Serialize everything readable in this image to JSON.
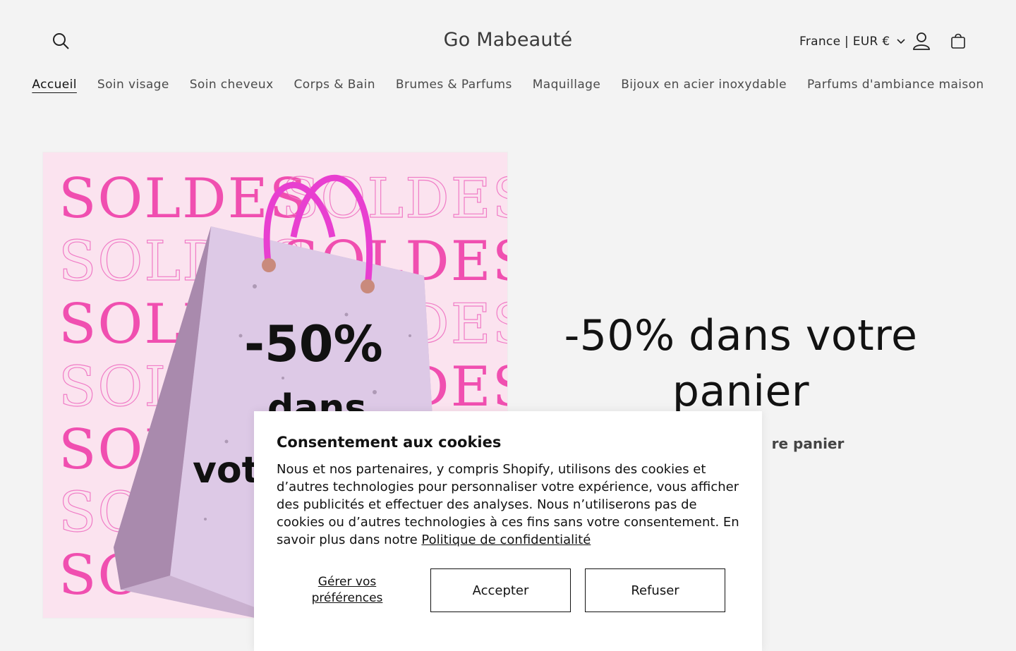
{
  "header": {
    "logo": "Go Mabeauté",
    "locale": "France | EUR €"
  },
  "nav": {
    "items": [
      "Accueil",
      "Soin visage",
      "Soin cheveux",
      "Corps & Bain",
      "Brumes & Parfums",
      "Maquillage",
      "Bijoux en acier inoxydable",
      "Parfums d'ambiance maison"
    ],
    "active": "Accueil"
  },
  "hero": {
    "image_text": {
      "word": "SOLDES",
      "discount": "-50%",
      "line2": "dans",
      "line3": "vot"
    },
    "title": "-50% dans votre panier",
    "subtitle_visible": "re panier"
  },
  "cookie": {
    "title": "Consentement aux cookies",
    "text": "Nous et nos partenaires, y compris Shopify, utilisons des cookies et d’autres technologies pour personnaliser votre expérience, vous afficher des publicités et effectuer des analyses. Nous n’utiliserons pas de cookies ou d’autres technologies à ces fins sans votre consentement. En savoir plus dans notre ",
    "policy_link": "Politique de confidentialité",
    "manage": "Gérer vos préférences",
    "accept": "Accepter",
    "refuse": "Refuser"
  },
  "colors": {
    "page_bg": "#f3f3f3",
    "hero_bg": "#fbe3ef",
    "soldes_pink": "#f04fb0",
    "bag_handle": "#e83fd0"
  },
  "icons": [
    "search-icon",
    "account-icon",
    "cart-icon",
    "chevron-down-icon"
  ]
}
